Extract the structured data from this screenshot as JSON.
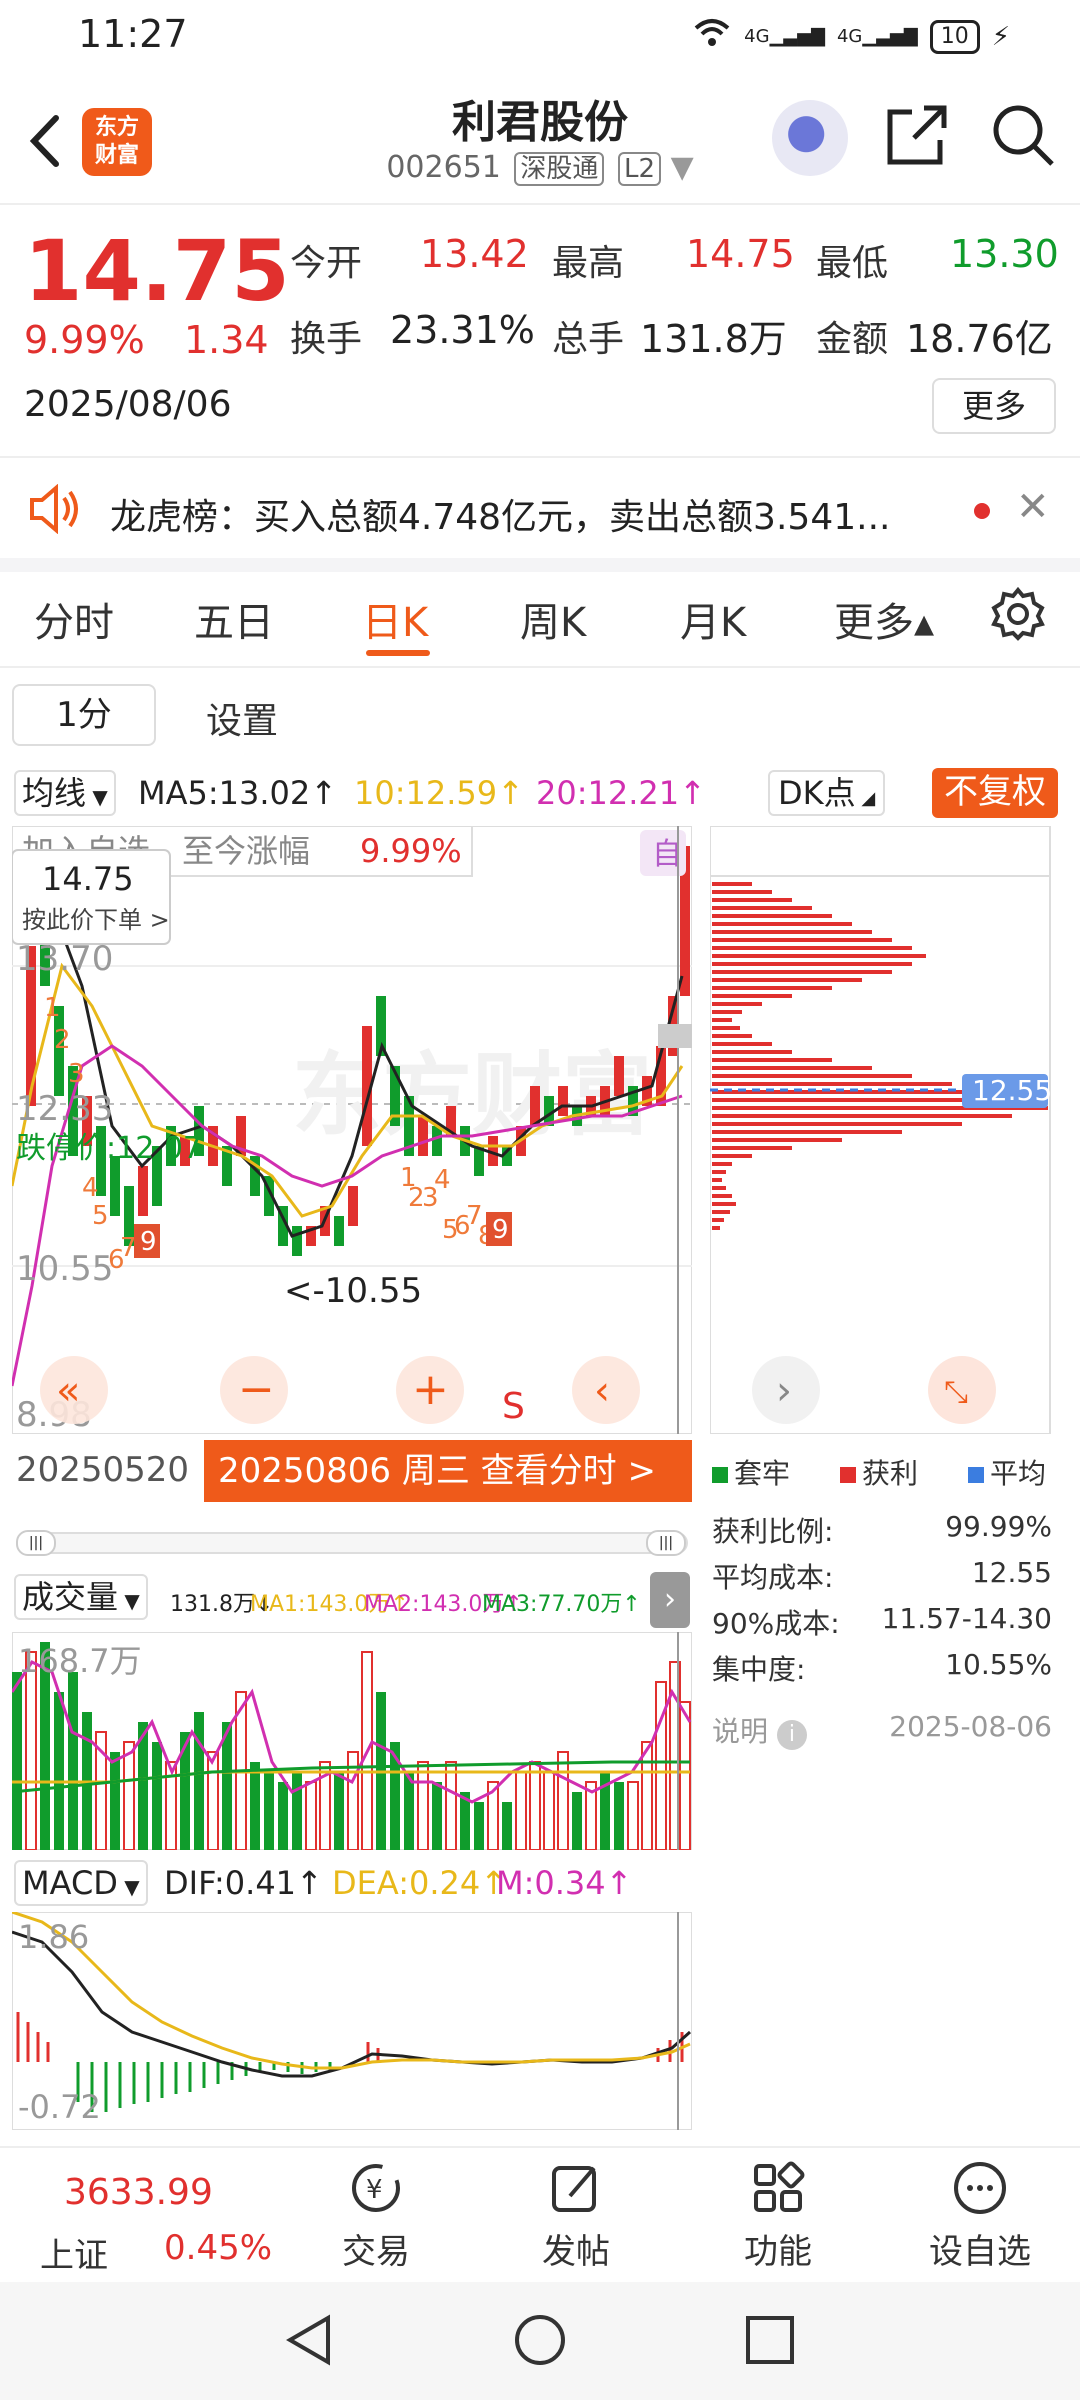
{
  "status": {
    "time": "11:27",
    "signal1": "4G",
    "signal2": "4G",
    "battery": "10"
  },
  "header": {
    "logo_line1": "东方",
    "logo_line2": "财富",
    "name": "利君股份",
    "code": "002651",
    "tag1": "深股通",
    "tag2": "L2"
  },
  "quote": {
    "price": "14.75",
    "pct": "9.99%",
    "change": "1.34",
    "date": "2025/08/06",
    "open_label": "今开",
    "open": "13.42",
    "high_label": "最高",
    "high": "14.75",
    "low_label": "最低",
    "low": "13.30",
    "turnover_label": "换手",
    "turnover": "23.31%",
    "volume_label": "总手",
    "volume": "131.8万",
    "amount_label": "金额",
    "amount": "18.76亿",
    "more": "更多"
  },
  "banner": {
    "text": "龙虎榜：买入总额4.748亿元，卖出总额3.541..."
  },
  "tabs": [
    "分时",
    "五日",
    "日K",
    "周K",
    "月K",
    "更多▴"
  ],
  "period": {
    "current": "1分",
    "settings": "设置"
  },
  "ma": {
    "select": "均线",
    "ma5": "MA5:13.02↑",
    "ma10": "10:12.59↑",
    "ma20": "20:12.21↑",
    "dk": "DK点",
    "fq": "不复权"
  },
  "kline": {
    "overlay_text": "加入自选，至今涨幅",
    "overlay_pct": "9.99%",
    "self_badge": "自",
    "price_tag": "14.75",
    "order_hint": "按此价下单 >",
    "y_top": "13.70",
    "y_mid": "12.33",
    "limit_down": "跌停价:12.07",
    "y_low": "10.55",
    "y_min": "8.98",
    "low_marker": "<-10.55",
    "s_marker": "S",
    "date_start": "20250520",
    "date_bar": "20250806 周三 查看分时 >"
  },
  "chips": {
    "avg_tag": "12.55",
    "legend": [
      "套牢",
      "获利",
      "平均"
    ],
    "rows": [
      {
        "label": "获利比例:",
        "value": "99.99%"
      },
      {
        "label": "平均成本:",
        "value": "12.55"
      },
      {
        "label": "90%成本:",
        "value": "11.57-14.30"
      },
      {
        "label": "集中度:",
        "value": "10.55%"
      }
    ],
    "note_label": "说明",
    "note_date": "2025-08-06"
  },
  "volume": {
    "select": "成交量",
    "total": "131.8万↓",
    "ma1": "MA1:143.0万↑",
    "ma2": "MA2:143.0万↑",
    "ma3": "MA3:77.70万↑",
    "y_top": "168.7万"
  },
  "macd": {
    "select": "MACD",
    "dif": "DIF:0.41↑",
    "dea": "DEA:0.24↑",
    "m": "M:0.34↑",
    "y_top": "1.86",
    "y_bottom": "-0.72"
  },
  "bottom_nav": {
    "index_value": "3633.99",
    "index_name": "上证",
    "index_pct": "0.45%",
    "items": [
      "交易",
      "发帖",
      "功能",
      "设自选"
    ]
  },
  "colors": {
    "up": "#e1302e",
    "down": "#109c2c",
    "accent": "#ef5a1a",
    "ma10": "#e8b81a",
    "ma20": "#d12fb0",
    "avg": "#3b7de0"
  }
}
